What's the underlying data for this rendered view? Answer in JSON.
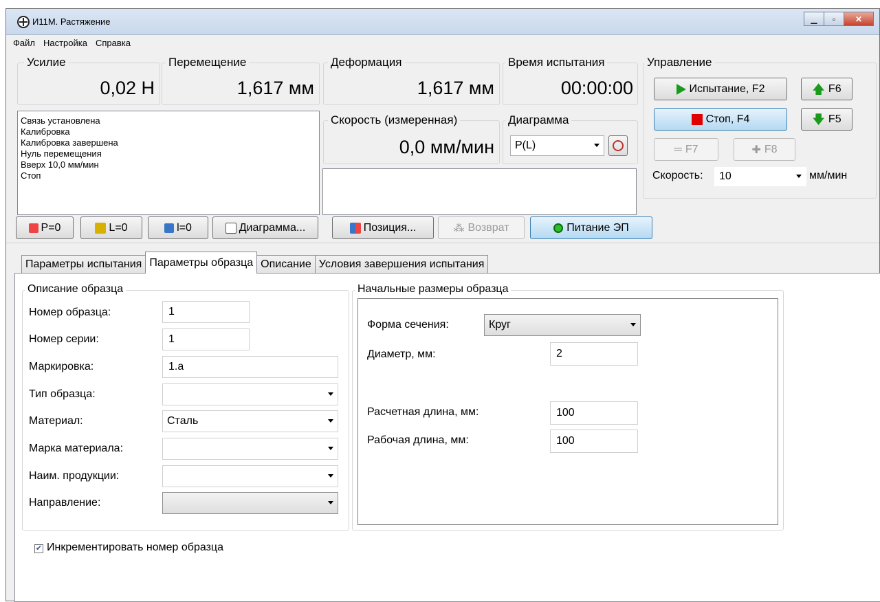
{
  "window": {
    "title": "И11М. Растяжение"
  },
  "menu": [
    "Файл",
    "Настройка",
    "Справка"
  ],
  "readouts": {
    "force": {
      "label": "Усилие",
      "value": "0,02 Н"
    },
    "displacement": {
      "label": "Перемещение",
      "value": "1,617 мм"
    },
    "deformation": {
      "label": "Деформация",
      "value": "1,617 мм"
    },
    "time": {
      "label": "Время испытания",
      "value": "00:00:00"
    },
    "speed": {
      "label": "Скорость (измеренная)",
      "value": "0,0 мм/мин"
    },
    "diagram": {
      "label": "Диаграмма",
      "selected": "P(L)"
    }
  },
  "log": [
    "Связь установлена",
    "Калибровка",
    "Калибровка завершена",
    "Нуль перемещения",
    "Вверх 10,0 мм/мин",
    "Стоп"
  ],
  "control": {
    "title": "Управление",
    "test_label": "Испытание, F2",
    "f6_label": "F6",
    "stop_label": "Стоп, F4",
    "f5_label": "F5",
    "f7_label": "F7",
    "f8_label": "F8",
    "speed_label": "Скорость:",
    "speed_value": "10",
    "speed_unit": "мм/мин"
  },
  "toolbar": {
    "p0": "P=0",
    "l0": "L=0",
    "i0": "l=0",
    "diagram": "Диаграмма...",
    "position": "Позиция...",
    "return": "Возврат",
    "power": "Питание ЭП"
  },
  "tabs": [
    "Параметры испытания",
    "Параметры образца",
    "Описание",
    "Условия завершения испытания"
  ],
  "sample": {
    "title": "Описание образца",
    "number_label": "Номер образца:",
    "number_value": "1",
    "series_label": "Номер серии:",
    "series_value": "1",
    "marking_label": "Маркировка:",
    "marking_value": "1.а",
    "type_label": "Тип образца:",
    "type_value": "",
    "material_label": "Материал:",
    "material_value": "Сталь",
    "grade_label": "Марка материала:",
    "grade_value": "",
    "product_label": "Наим. продукции:",
    "product_value": "",
    "direction_label": "Направление:",
    "direction_value": ""
  },
  "dims": {
    "title": "Начальные размеры образца",
    "shape_label": "Форма сечения:",
    "shape_value": "Круг",
    "diameter_label": "Диаметр, мм:",
    "diameter_value": "2",
    "calc_length_label": "Расчетная длина, мм:",
    "calc_length_value": "100",
    "work_length_label": "Рабочая длина, мм:",
    "work_length_value": "100"
  },
  "increment": {
    "label": "Инкрементировать номер образца",
    "checked": true
  }
}
